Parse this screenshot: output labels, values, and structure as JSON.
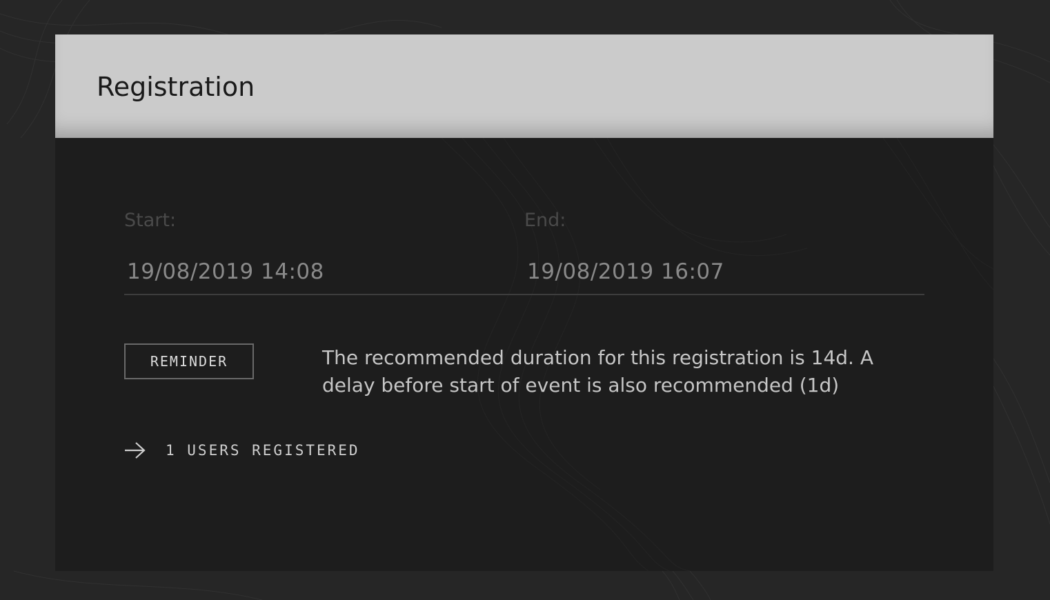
{
  "theme": {
    "page_bg": "#262626",
    "panel_bg": "#1d1d1d",
    "header_bg": "#cbcbcb"
  },
  "panel": {
    "title": "Registration"
  },
  "fields": {
    "start": {
      "label": "Start:",
      "value": "19/08/2019 14:08"
    },
    "end": {
      "label": "End:",
      "value": "19/08/2019 16:07"
    }
  },
  "reminder": {
    "button_label": "REMINDER",
    "text": "The recommended duration for this registration is 14d. A delay before start of event is also recommended (1d)"
  },
  "registered": {
    "icon": "arrow-right-icon",
    "label": "1 USERS REGISTERED"
  }
}
